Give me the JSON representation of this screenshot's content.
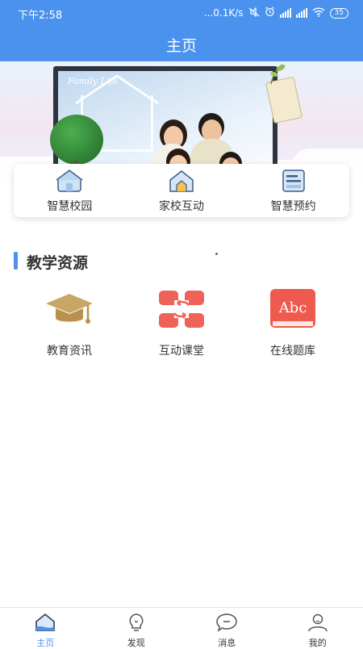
{
  "status_bar": {
    "time": "下午2:58",
    "network_speed": "...0.1K/s",
    "battery": "35"
  },
  "header": {
    "title": "主页"
  },
  "banner": {
    "caption": "Family Life"
  },
  "quick_actions": [
    {
      "label": "智慧校园",
      "icon": "campus-house-icon"
    },
    {
      "label": "家校互动",
      "icon": "home-school-icon"
    },
    {
      "label": "智慧预约",
      "icon": "appointment-card-icon"
    }
  ],
  "section": {
    "title": "教学资源"
  },
  "resources": [
    {
      "label": "教育资讯",
      "icon": "graduation-cap-icon",
      "color": "#c8a664"
    },
    {
      "label": "互动课堂",
      "icon": "interactive-class-icon",
      "color": "#ef6258"
    },
    {
      "label": "在线题库",
      "icon": "abc-book-icon",
      "color": "#ef5a4e",
      "icon_text": "Abc"
    }
  ],
  "tabbar": {
    "items": [
      {
        "label": "主页",
        "icon": "home-icon",
        "active": true
      },
      {
        "label": "发现",
        "icon": "lightbulb-icon",
        "active": false
      },
      {
        "label": "消息",
        "icon": "message-bubble-icon",
        "active": false
      },
      {
        "label": "我的",
        "icon": "user-icon",
        "active": false
      }
    ]
  },
  "colors": {
    "primary": "#4a92ee",
    "text": "#333333"
  }
}
